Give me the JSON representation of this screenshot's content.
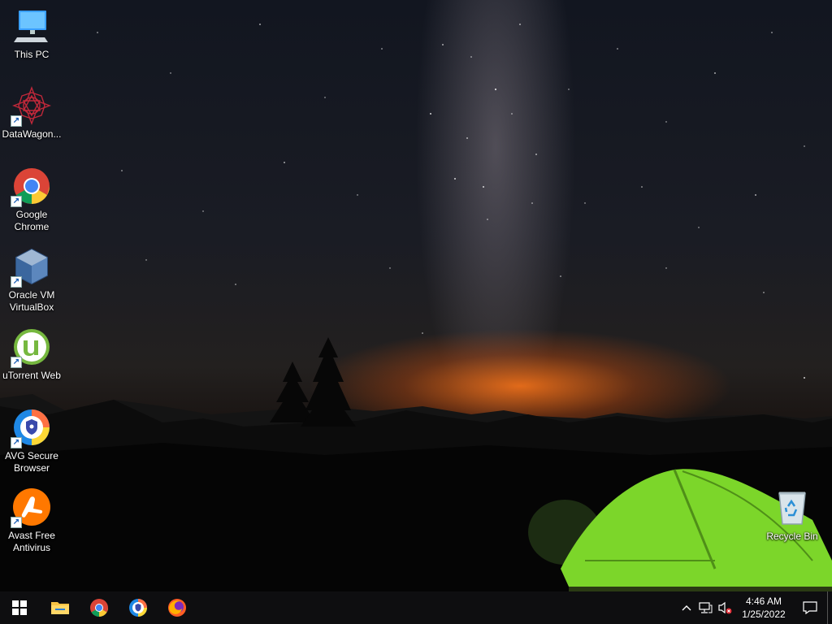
{
  "desktop": {
    "icons": [
      {
        "label": "This PC",
        "icon": "computer-icon"
      },
      {
        "label": "DataWagon...",
        "icon": "datawagon-icon"
      },
      {
        "label": "Google Chrome",
        "icon": "chrome-icon"
      },
      {
        "label": "Oracle VM VirtualBox",
        "icon": "virtualbox-icon"
      },
      {
        "label": "uTorrent Web",
        "icon": "utorrent-icon"
      },
      {
        "label": "AVG Secure Browser",
        "icon": "avg-browser-icon"
      },
      {
        "label": "Avast Free Antivirus",
        "icon": "avast-icon"
      }
    ],
    "recycle_bin": {
      "label": "Recycle Bin",
      "icon": "recycle-bin-icon"
    }
  },
  "taskbar": {
    "pinned": [
      {
        "name": "start",
        "icon": "windows-icon"
      },
      {
        "name": "file-explorer",
        "icon": "folder-icon"
      },
      {
        "name": "chrome",
        "icon": "chrome-icon"
      },
      {
        "name": "avg-browser",
        "icon": "avg-browser-icon"
      },
      {
        "name": "firefox",
        "icon": "firefox-icon"
      }
    ],
    "tray": {
      "chevron": "chevron-up-icon",
      "network": "network-icon",
      "volume": "volume-muted-icon",
      "time": "4:46 AM",
      "date": "1/25/2022",
      "notifications": "notification-icon"
    }
  },
  "colors": {
    "taskbar": "#0e0e10",
    "sky_glow": "#eb6e19",
    "tent": "#7cd62a",
    "windows_blue": "#1a8cff"
  }
}
